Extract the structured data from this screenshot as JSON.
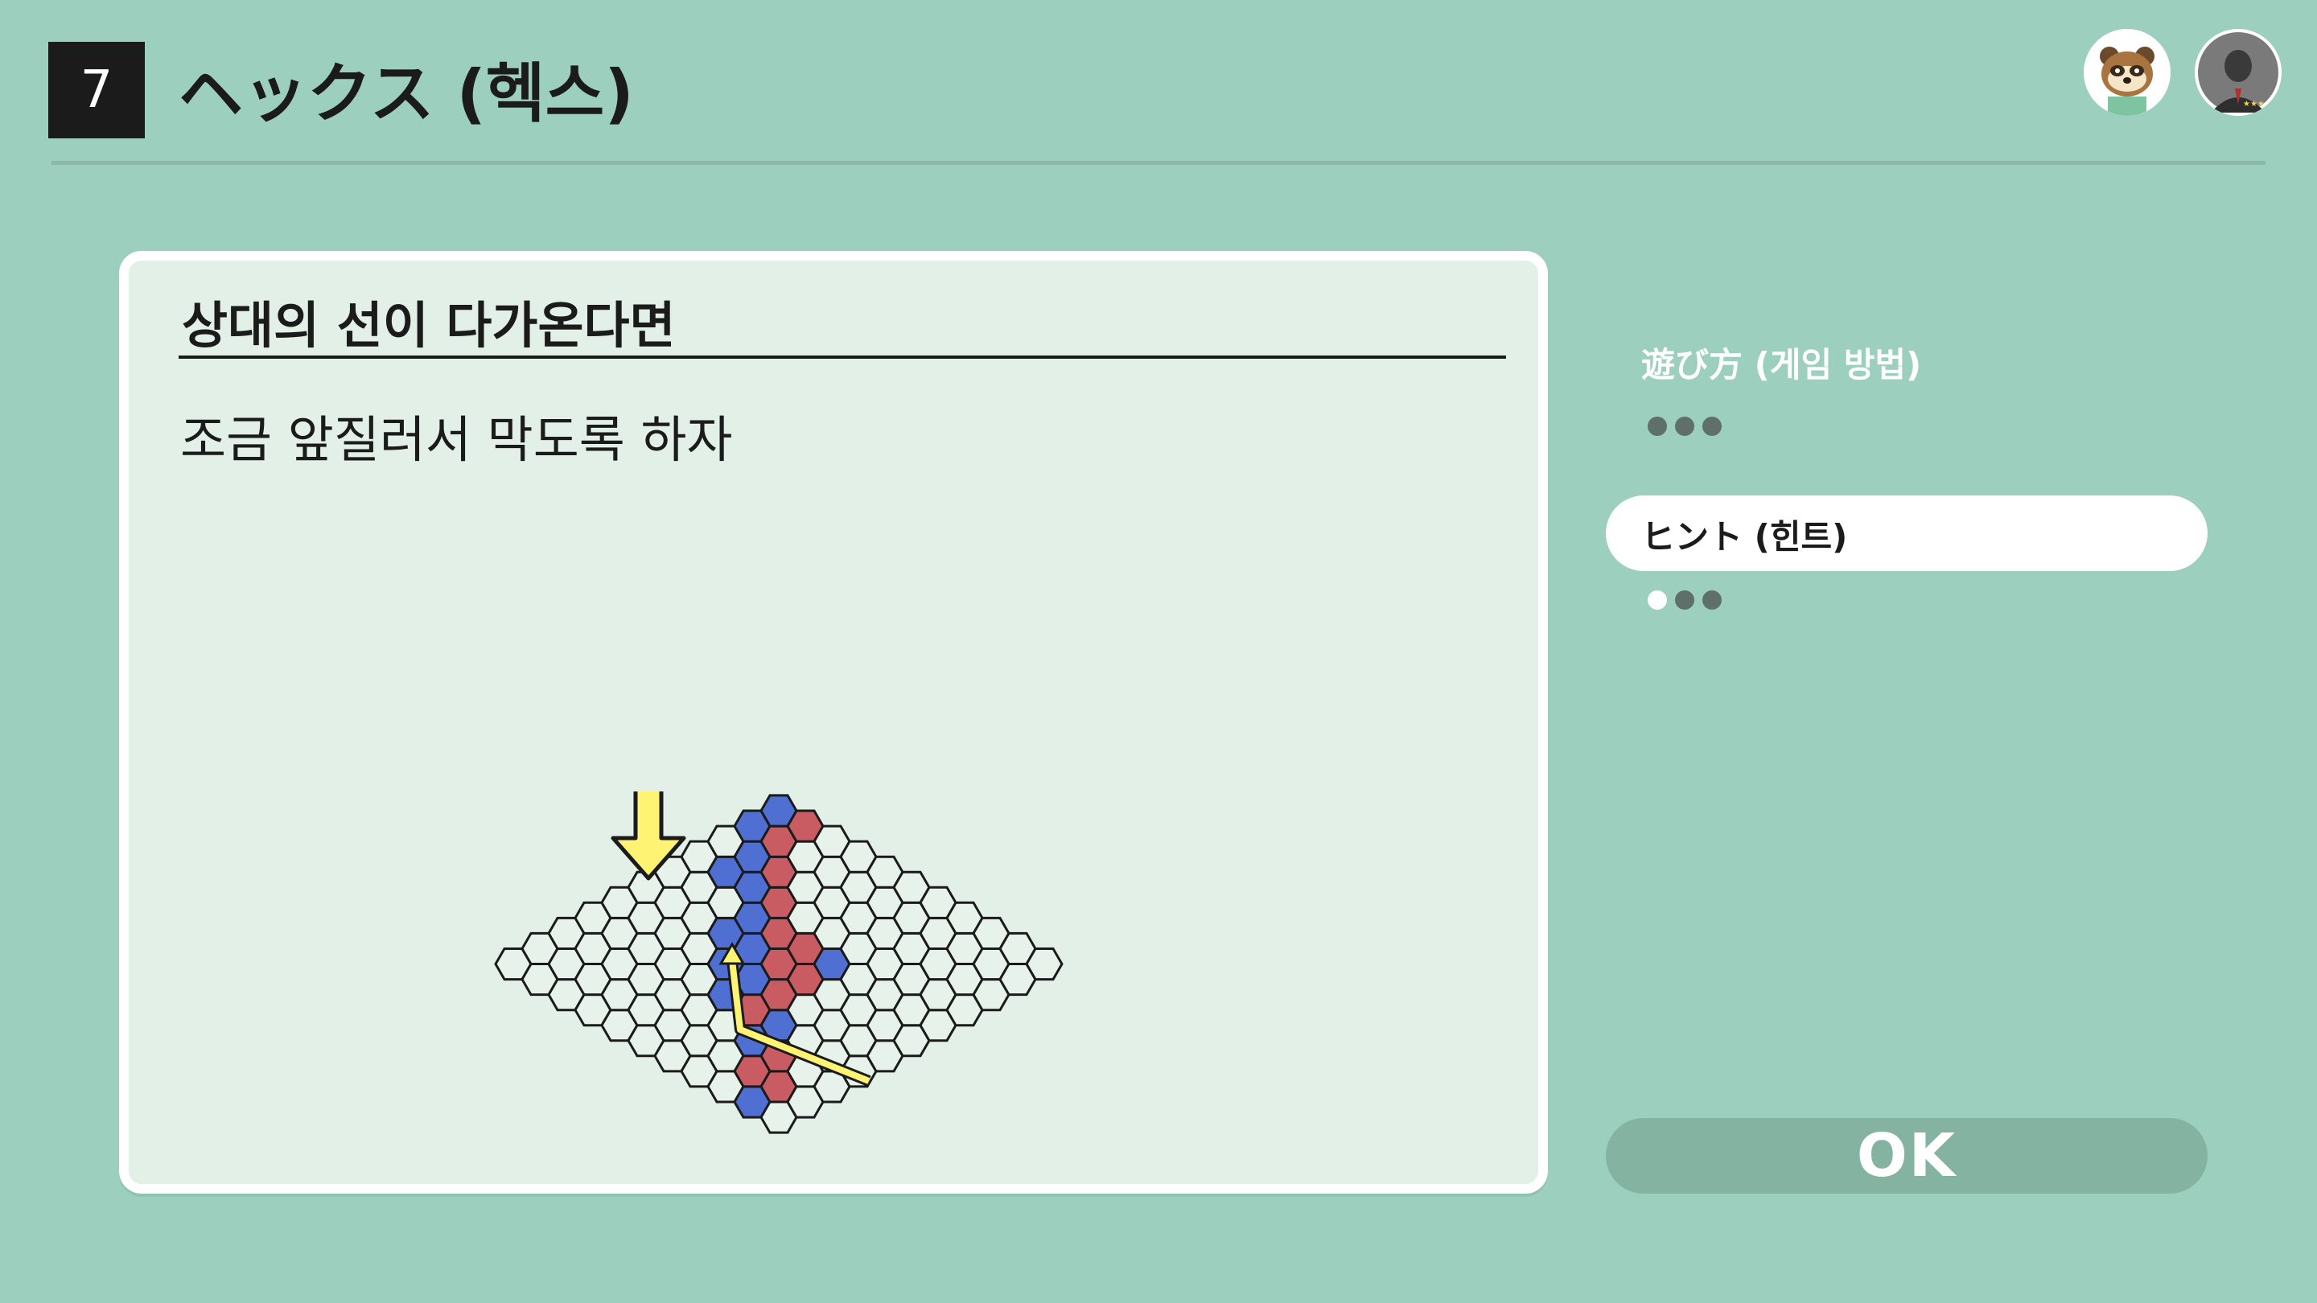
{
  "header": {
    "number": "7",
    "title": "ヘックス (헥스)"
  },
  "hint_panel": {
    "heading": "상대의 선이 다가온다면",
    "body": "조금 앞질러서 막도록 하자"
  },
  "menu": {
    "how_to_play": {
      "label": "遊び方 (게임 방법)",
      "pages": 3,
      "current_page": 0
    },
    "hints": {
      "label": "ヒント (힌트)",
      "pages": 3,
      "current_page": 1,
      "selected": true
    }
  },
  "ok_button": {
    "label": "OK"
  },
  "colors": {
    "background": "#9ccfbd",
    "panel": "#e2f0e7",
    "blue_piece": "#4f6fd3",
    "red_piece": "#c95c62",
    "arrow": "#fff373"
  },
  "icons": {
    "player1_avatar": "raccoon-avatar-icon",
    "player2_avatar": "person-avatar-icon",
    "drop_arrow": "down-arrow-icon",
    "path_arrow": "bent-arrow-icon"
  }
}
